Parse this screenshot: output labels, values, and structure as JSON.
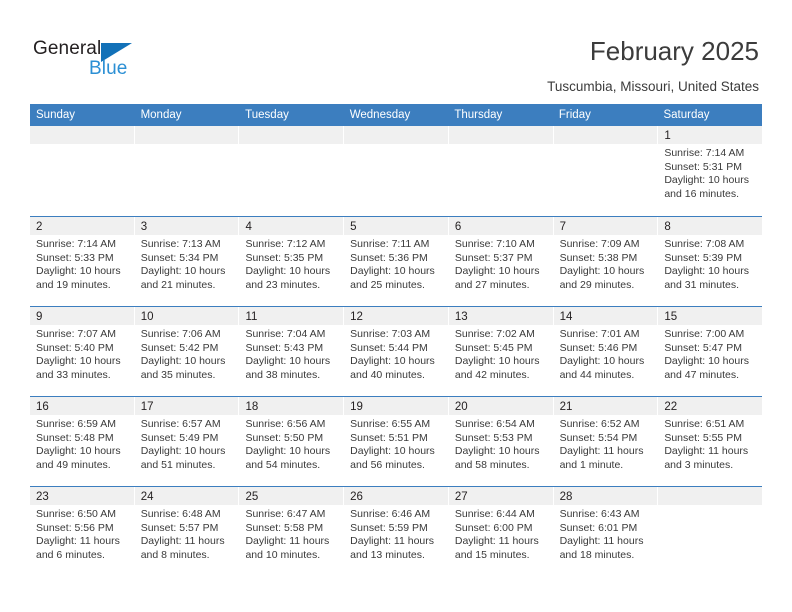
{
  "brand": {
    "name_dark": "General",
    "name_blue": "Blue",
    "color_dark": "#231f20",
    "color_blue": "#2b8fd4",
    "triangle_color": "#1271b8"
  },
  "header": {
    "title": "February 2025",
    "subtitle": "Tuscumbia, Missouri, United States"
  },
  "theme": {
    "header_row_bg": "#3c7ebf",
    "header_row_text": "#ffffff",
    "daynum_band_bg": "#f0f0f0",
    "week_separator": "#3c7ebf",
    "page_bg": "#ffffff",
    "body_text": "#3a3a3a"
  },
  "weekdays": [
    "Sunday",
    "Monday",
    "Tuesday",
    "Wednesday",
    "Thursday",
    "Friday",
    "Saturday"
  ],
  "weeks": [
    [
      {
        "day": ""
      },
      {
        "day": ""
      },
      {
        "day": ""
      },
      {
        "day": ""
      },
      {
        "day": ""
      },
      {
        "day": ""
      },
      {
        "day": "1",
        "sunrise": "Sunrise: 7:14 AM",
        "sunset": "Sunset: 5:31 PM",
        "daylight": "Daylight: 10 hours and 16 minutes."
      }
    ],
    [
      {
        "day": "2",
        "sunrise": "Sunrise: 7:14 AM",
        "sunset": "Sunset: 5:33 PM",
        "daylight": "Daylight: 10 hours and 19 minutes."
      },
      {
        "day": "3",
        "sunrise": "Sunrise: 7:13 AM",
        "sunset": "Sunset: 5:34 PM",
        "daylight": "Daylight: 10 hours and 21 minutes."
      },
      {
        "day": "4",
        "sunrise": "Sunrise: 7:12 AM",
        "sunset": "Sunset: 5:35 PM",
        "daylight": "Daylight: 10 hours and 23 minutes."
      },
      {
        "day": "5",
        "sunrise": "Sunrise: 7:11 AM",
        "sunset": "Sunset: 5:36 PM",
        "daylight": "Daylight: 10 hours and 25 minutes."
      },
      {
        "day": "6",
        "sunrise": "Sunrise: 7:10 AM",
        "sunset": "Sunset: 5:37 PM",
        "daylight": "Daylight: 10 hours and 27 minutes."
      },
      {
        "day": "7",
        "sunrise": "Sunrise: 7:09 AM",
        "sunset": "Sunset: 5:38 PM",
        "daylight": "Daylight: 10 hours and 29 minutes."
      },
      {
        "day": "8",
        "sunrise": "Sunrise: 7:08 AM",
        "sunset": "Sunset: 5:39 PM",
        "daylight": "Daylight: 10 hours and 31 minutes."
      }
    ],
    [
      {
        "day": "9",
        "sunrise": "Sunrise: 7:07 AM",
        "sunset": "Sunset: 5:40 PM",
        "daylight": "Daylight: 10 hours and 33 minutes."
      },
      {
        "day": "10",
        "sunrise": "Sunrise: 7:06 AM",
        "sunset": "Sunset: 5:42 PM",
        "daylight": "Daylight: 10 hours and 35 minutes."
      },
      {
        "day": "11",
        "sunrise": "Sunrise: 7:04 AM",
        "sunset": "Sunset: 5:43 PM",
        "daylight": "Daylight: 10 hours and 38 minutes."
      },
      {
        "day": "12",
        "sunrise": "Sunrise: 7:03 AM",
        "sunset": "Sunset: 5:44 PM",
        "daylight": "Daylight: 10 hours and 40 minutes."
      },
      {
        "day": "13",
        "sunrise": "Sunrise: 7:02 AM",
        "sunset": "Sunset: 5:45 PM",
        "daylight": "Daylight: 10 hours and 42 minutes."
      },
      {
        "day": "14",
        "sunrise": "Sunrise: 7:01 AM",
        "sunset": "Sunset: 5:46 PM",
        "daylight": "Daylight: 10 hours and 44 minutes."
      },
      {
        "day": "15",
        "sunrise": "Sunrise: 7:00 AM",
        "sunset": "Sunset: 5:47 PM",
        "daylight": "Daylight: 10 hours and 47 minutes."
      }
    ],
    [
      {
        "day": "16",
        "sunrise": "Sunrise: 6:59 AM",
        "sunset": "Sunset: 5:48 PM",
        "daylight": "Daylight: 10 hours and 49 minutes."
      },
      {
        "day": "17",
        "sunrise": "Sunrise: 6:57 AM",
        "sunset": "Sunset: 5:49 PM",
        "daylight": "Daylight: 10 hours and 51 minutes."
      },
      {
        "day": "18",
        "sunrise": "Sunrise: 6:56 AM",
        "sunset": "Sunset: 5:50 PM",
        "daylight": "Daylight: 10 hours and 54 minutes."
      },
      {
        "day": "19",
        "sunrise": "Sunrise: 6:55 AM",
        "sunset": "Sunset: 5:51 PM",
        "daylight": "Daylight: 10 hours and 56 minutes."
      },
      {
        "day": "20",
        "sunrise": "Sunrise: 6:54 AM",
        "sunset": "Sunset: 5:53 PM",
        "daylight": "Daylight: 10 hours and 58 minutes."
      },
      {
        "day": "21",
        "sunrise": "Sunrise: 6:52 AM",
        "sunset": "Sunset: 5:54 PM",
        "daylight": "Daylight: 11 hours and 1 minute."
      },
      {
        "day": "22",
        "sunrise": "Sunrise: 6:51 AM",
        "sunset": "Sunset: 5:55 PM",
        "daylight": "Daylight: 11 hours and 3 minutes."
      }
    ],
    [
      {
        "day": "23",
        "sunrise": "Sunrise: 6:50 AM",
        "sunset": "Sunset: 5:56 PM",
        "daylight": "Daylight: 11 hours and 6 minutes."
      },
      {
        "day": "24",
        "sunrise": "Sunrise: 6:48 AM",
        "sunset": "Sunset: 5:57 PM",
        "daylight": "Daylight: 11 hours and 8 minutes."
      },
      {
        "day": "25",
        "sunrise": "Sunrise: 6:47 AM",
        "sunset": "Sunset: 5:58 PM",
        "daylight": "Daylight: 11 hours and 10 minutes."
      },
      {
        "day": "26",
        "sunrise": "Sunrise: 6:46 AM",
        "sunset": "Sunset: 5:59 PM",
        "daylight": "Daylight: 11 hours and 13 minutes."
      },
      {
        "day": "27",
        "sunrise": "Sunrise: 6:44 AM",
        "sunset": "Sunset: 6:00 PM",
        "daylight": "Daylight: 11 hours and 15 minutes."
      },
      {
        "day": "28",
        "sunrise": "Sunrise: 6:43 AM",
        "sunset": "Sunset: 6:01 PM",
        "daylight": "Daylight: 11 hours and 18 minutes."
      },
      {
        "day": ""
      }
    ]
  ]
}
